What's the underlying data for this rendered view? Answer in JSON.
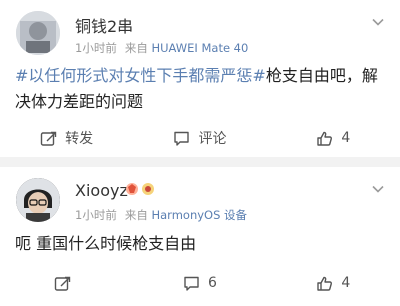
{
  "posts": [
    {
      "user": "铜钱2串",
      "meta_time": "1小时前",
      "meta_source_prefix": "来自",
      "meta_source": "HUAWEI Mate 40",
      "content_tag": "#以任何形式对女性下手都需严惩#",
      "content_text": "枪支自由吧，解决体力差距的问题",
      "repost_label": "转发",
      "comment_label": "评论",
      "like_count": "4"
    },
    {
      "user": "Xiooyz",
      "meta_time": "1小时前",
      "meta_source_prefix": "来自",
      "meta_source": "HarmonyOS 设备",
      "content_text": "呃 重国什么时候枪支自由",
      "repost_label": "",
      "comment_count": "6",
      "like_count": "4"
    }
  ]
}
